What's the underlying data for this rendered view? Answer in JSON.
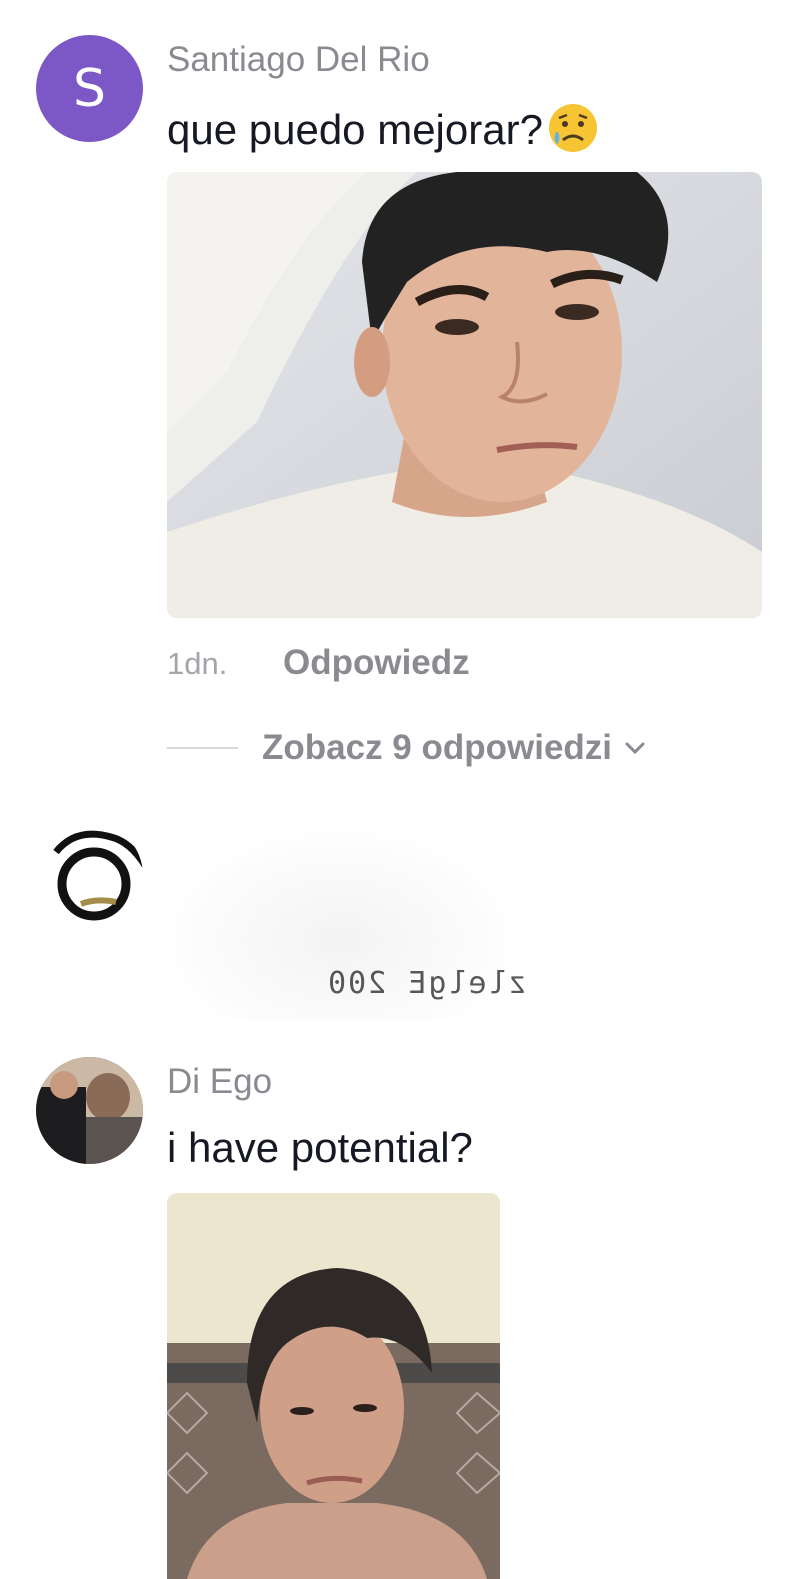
{
  "comments": [
    {
      "username": "Santiago Del Rio",
      "avatar_letter": "S",
      "text": "que puedo mejorar?",
      "emoji": "sad-but-relieved-face",
      "time": "1dn.",
      "reply_label": "Odpowiedz",
      "view_replies_label": "Zobacz 9 odpowiedzi",
      "attachment": "selfie-photo"
    },
    {
      "sticker_text": "zlelgE 200",
      "avatar": "sketch-ring-avatar"
    },
    {
      "username": "Di Ego",
      "text": "i have potential?",
      "attachment": "selfie-photo"
    }
  ],
  "colors": {
    "avatar_purple": "#7c57c6",
    "secondary_text": "#8a8b91",
    "primary_text": "#161823"
  }
}
